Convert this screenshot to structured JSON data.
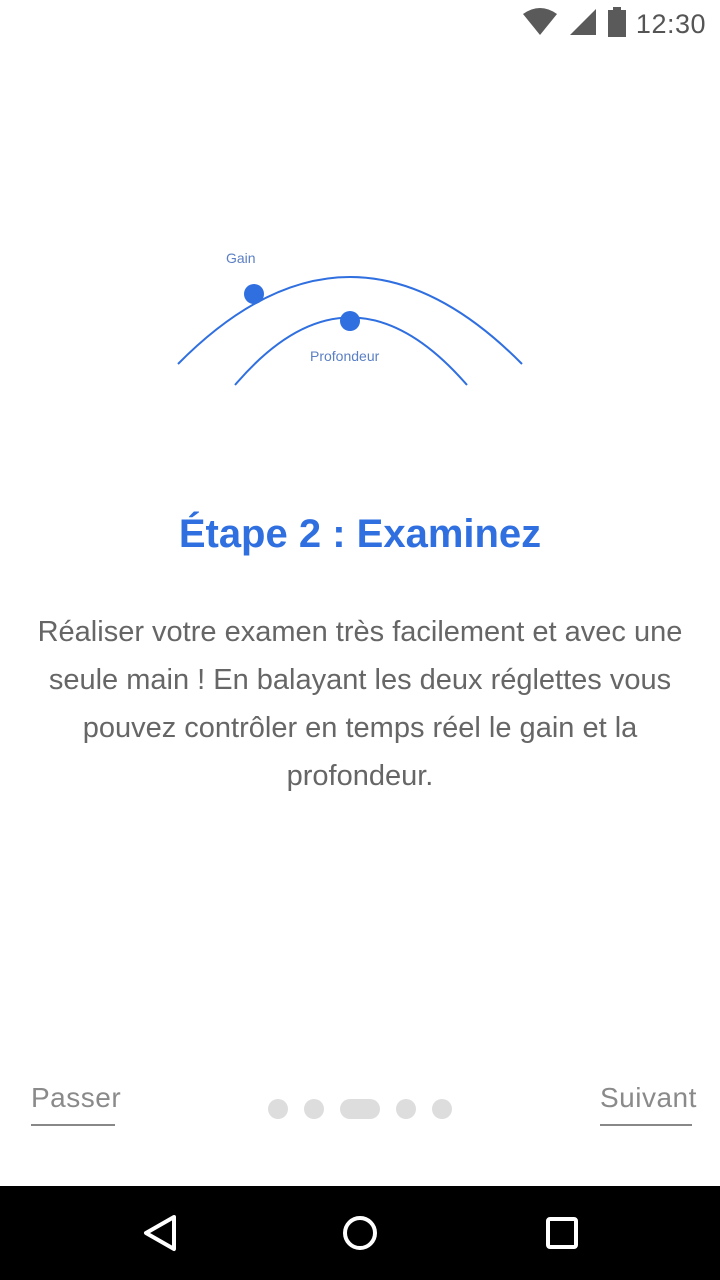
{
  "status_bar": {
    "time": "12:30",
    "icons": [
      "wifi-icon",
      "cell-signal-icon",
      "battery-icon"
    ]
  },
  "illustration": {
    "gain_label": "Gain",
    "depth_label": "Profondeur",
    "accent_color": "#2f6fe0"
  },
  "onboarding": {
    "title": "Étape 2 : Examinez",
    "description": "Réaliser votre examen très facilement et avec une seule main ! En balayant les deux réglettes vous pouvez contrôler en temps réel le gain et la profondeur.",
    "pager": {
      "total": 5,
      "active_index": 2
    },
    "skip_label": "Passer",
    "next_label": "Suivant"
  },
  "nav_bar": {
    "icons": [
      "back-icon",
      "home-icon",
      "recents-icon"
    ]
  },
  "colors": {
    "primary": "#2f6fe0",
    "body_text": "#666666",
    "muted": "#8a8a8a",
    "dot_inactive": "#dddddd"
  }
}
